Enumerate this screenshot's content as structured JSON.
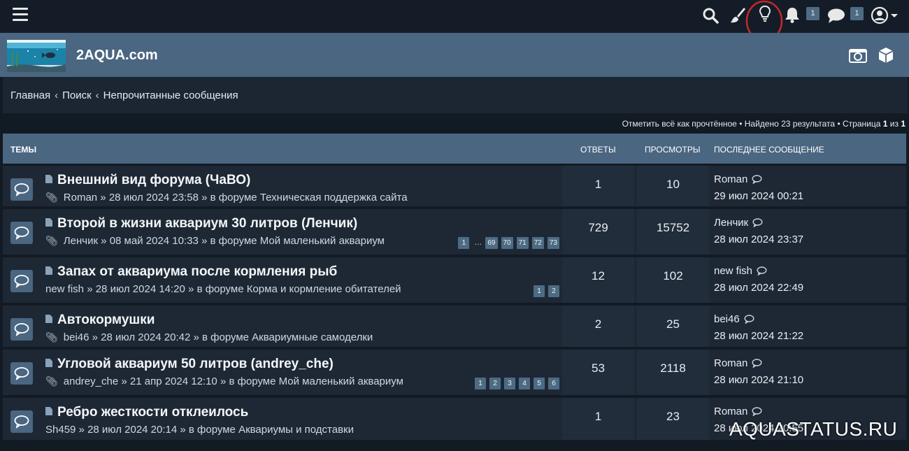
{
  "topbar": {
    "icons": [
      "menu-icon",
      "search-icon",
      "brush-icon",
      "lightbulb-icon",
      "bell-icon",
      "chat-icon",
      "user-icon",
      "caret-down-icon"
    ],
    "notifications_count": "1",
    "messages_count": "1",
    "highlight_color": "#c62828"
  },
  "header": {
    "site_title": "2AQUA.com",
    "icons": [
      "camera-icon",
      "cube-icon"
    ]
  },
  "breadcrumb": {
    "items": [
      "Главная",
      "Поиск",
      "Непрочитанные сообщения"
    ],
    "separator": "‹"
  },
  "pagination": {
    "mark_read": "Отметить всё как прочтённое",
    "found": "Найдено 23 результата",
    "page_label": "Страница",
    "page_current": "1",
    "of_label": "из",
    "page_total": "1",
    "bullet": "•"
  },
  "table": {
    "headers": {
      "topics": "ТЕМЫ",
      "answers": "ОТВЕТЫ",
      "views": "ПРОСМОТРЫ",
      "last": "ПОСЛЕДНЕЕ СООБЩЕНИЕ"
    },
    "rows": [
      {
        "title": "Внешний вид форума (ЧаВО)",
        "attach": true,
        "author": "Roman",
        "date": "28 июл 2024 23:58",
        "forum_prefix": "в форуме",
        "forum": "Техническая поддержка сайта",
        "pages": [],
        "answers": "1",
        "views": "10",
        "last_author": "Roman",
        "last_date": "29 июл 2024 00:21"
      },
      {
        "title": "Второй в жизни аквариум 30 литров (Ленчик)",
        "attach": true,
        "author": "Ленчик",
        "date": "08 май 2024 10:33",
        "forum_prefix": "в форуме",
        "forum": "Мой маленький аквариум",
        "pages": [
          "1",
          "…",
          "69",
          "70",
          "71",
          "72",
          "73"
        ],
        "answers": "729",
        "views": "15752",
        "last_author": "Ленчик",
        "last_date": "28 июл 2024 23:37"
      },
      {
        "title": "Запах от аквариума после кормления рыб",
        "attach": false,
        "author": "new fish",
        "date": "28 июл 2024 14:20",
        "forum_prefix": "в форуме",
        "forum": "Корма и кормление обитателей",
        "pages": [
          "1",
          "2"
        ],
        "answers": "12",
        "views": "102",
        "last_author": "new fish",
        "last_date": "28 июл 2024 22:49"
      },
      {
        "title": "Автокормушки",
        "attach": true,
        "author": "bei46",
        "date": "28 июл 2024 20:42",
        "forum_prefix": "в форуме",
        "forum": "Аквариумные самоделки",
        "pages": [],
        "answers": "2",
        "views": "25",
        "last_author": "bei46",
        "last_date": "28 июл 2024 21:22"
      },
      {
        "title": "Угловой аквариум 50 литров (andrey_che)",
        "attach": true,
        "author": "andrey_che",
        "date": "21 апр 2024 12:10",
        "forum_prefix": "в форуме",
        "forum": "Мой маленький аквариум",
        "pages": [
          "1",
          "2",
          "3",
          "4",
          "5",
          "6"
        ],
        "answers": "53",
        "views": "2118",
        "last_author": "Roman",
        "last_date": "28 июл 2024 21:10"
      },
      {
        "title": "Ребро жесткости отклеилось",
        "attach": false,
        "author": "Sh459",
        "date": "28 июл 2024 20:14",
        "forum_prefix": "в форуме",
        "forum": "Аквариумы и подставки",
        "pages": [],
        "answers": "1",
        "views": "23",
        "last_author": "Roman",
        "last_date": "28 июл 2024 20:55"
      }
    ]
  },
  "watermark": "AQUASTATUS.RU"
}
